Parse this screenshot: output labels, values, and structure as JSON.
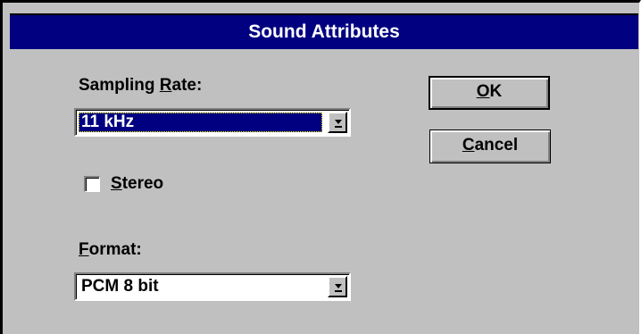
{
  "dialog": {
    "title": "Sound Attributes"
  },
  "sampling_rate": {
    "label_prefix": "Sampling ",
    "label_access_key": "R",
    "label_suffix": "ate:",
    "value": "11 kHz"
  },
  "stereo": {
    "label_access_key": "S",
    "label_rest": "tereo",
    "checked": false
  },
  "format": {
    "label_access_key": "F",
    "label_rest": "ormat:",
    "value": "PCM 8 bit"
  },
  "buttons": {
    "ok": {
      "access_key": "O",
      "rest": "K"
    },
    "cancel": {
      "access_key": "C",
      "rest": "ancel"
    }
  },
  "icons": {
    "dropdown": "dropdown-arrow-icon"
  },
  "colors": {
    "titlebar": "#000080",
    "face": "#c0c0c0",
    "selection": "#000080"
  }
}
